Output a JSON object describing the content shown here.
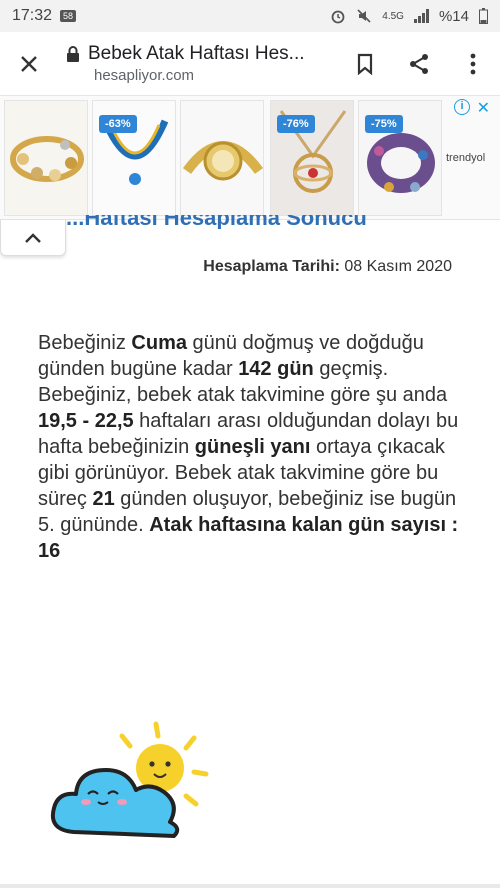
{
  "status_bar": {
    "time": "17:32",
    "notif_badge": "58",
    "network": "4.5G",
    "battery": "%14"
  },
  "browser": {
    "page_title": "Bebek Atak Haftası Hes...",
    "host": "hesapliyor.com"
  },
  "ads": {
    "discounts": [
      "-63%",
      "-76%",
      "-75%"
    ],
    "brand": "trendyol"
  },
  "article": {
    "cut_heading": "...Haftası Hesaplama Sonucu",
    "date_label": "Hesaplama Tarihi:",
    "date_value": "08 Kasım 2020",
    "p": {
      "t1": "Bebeğiniz ",
      "b1": "Cuma",
      "t2": " günü doğmuş ve doğduğu günden bugüne kadar ",
      "b2": "142 gün",
      "t3": " geçmiş. Bebeğiniz, bebek atak takvimine göre şu anda ",
      "b3": "19,5 - 22,5",
      "t4": " haftaları arası olduğundan dolayı bu hafta bebeğinizin ",
      "b4": "güneşli yanı",
      "t5": " ortaya çıkacak gibi görünüyor. Bebek atak takvimine göre bu süreç ",
      "b5": "21",
      "t6": " günden oluşuyor, bebeğiniz ise bugün 5. gününde. ",
      "b6": "Atak haftasına kalan gün sayısı : 16"
    }
  },
  "icons": {
    "close": "close-icon",
    "lock": "lock-icon",
    "bookmark": "bookmark-icon",
    "share": "share-icon",
    "menu": "more-vert-icon",
    "collapse": "chevron-up-icon",
    "weather": "sun-cloud-icon"
  },
  "colors": {
    "link_blue": "#2f6fb6",
    "ad_discount": "#2f86d6",
    "cloud": "#4fc3f0",
    "sun": "#f7d12b"
  }
}
